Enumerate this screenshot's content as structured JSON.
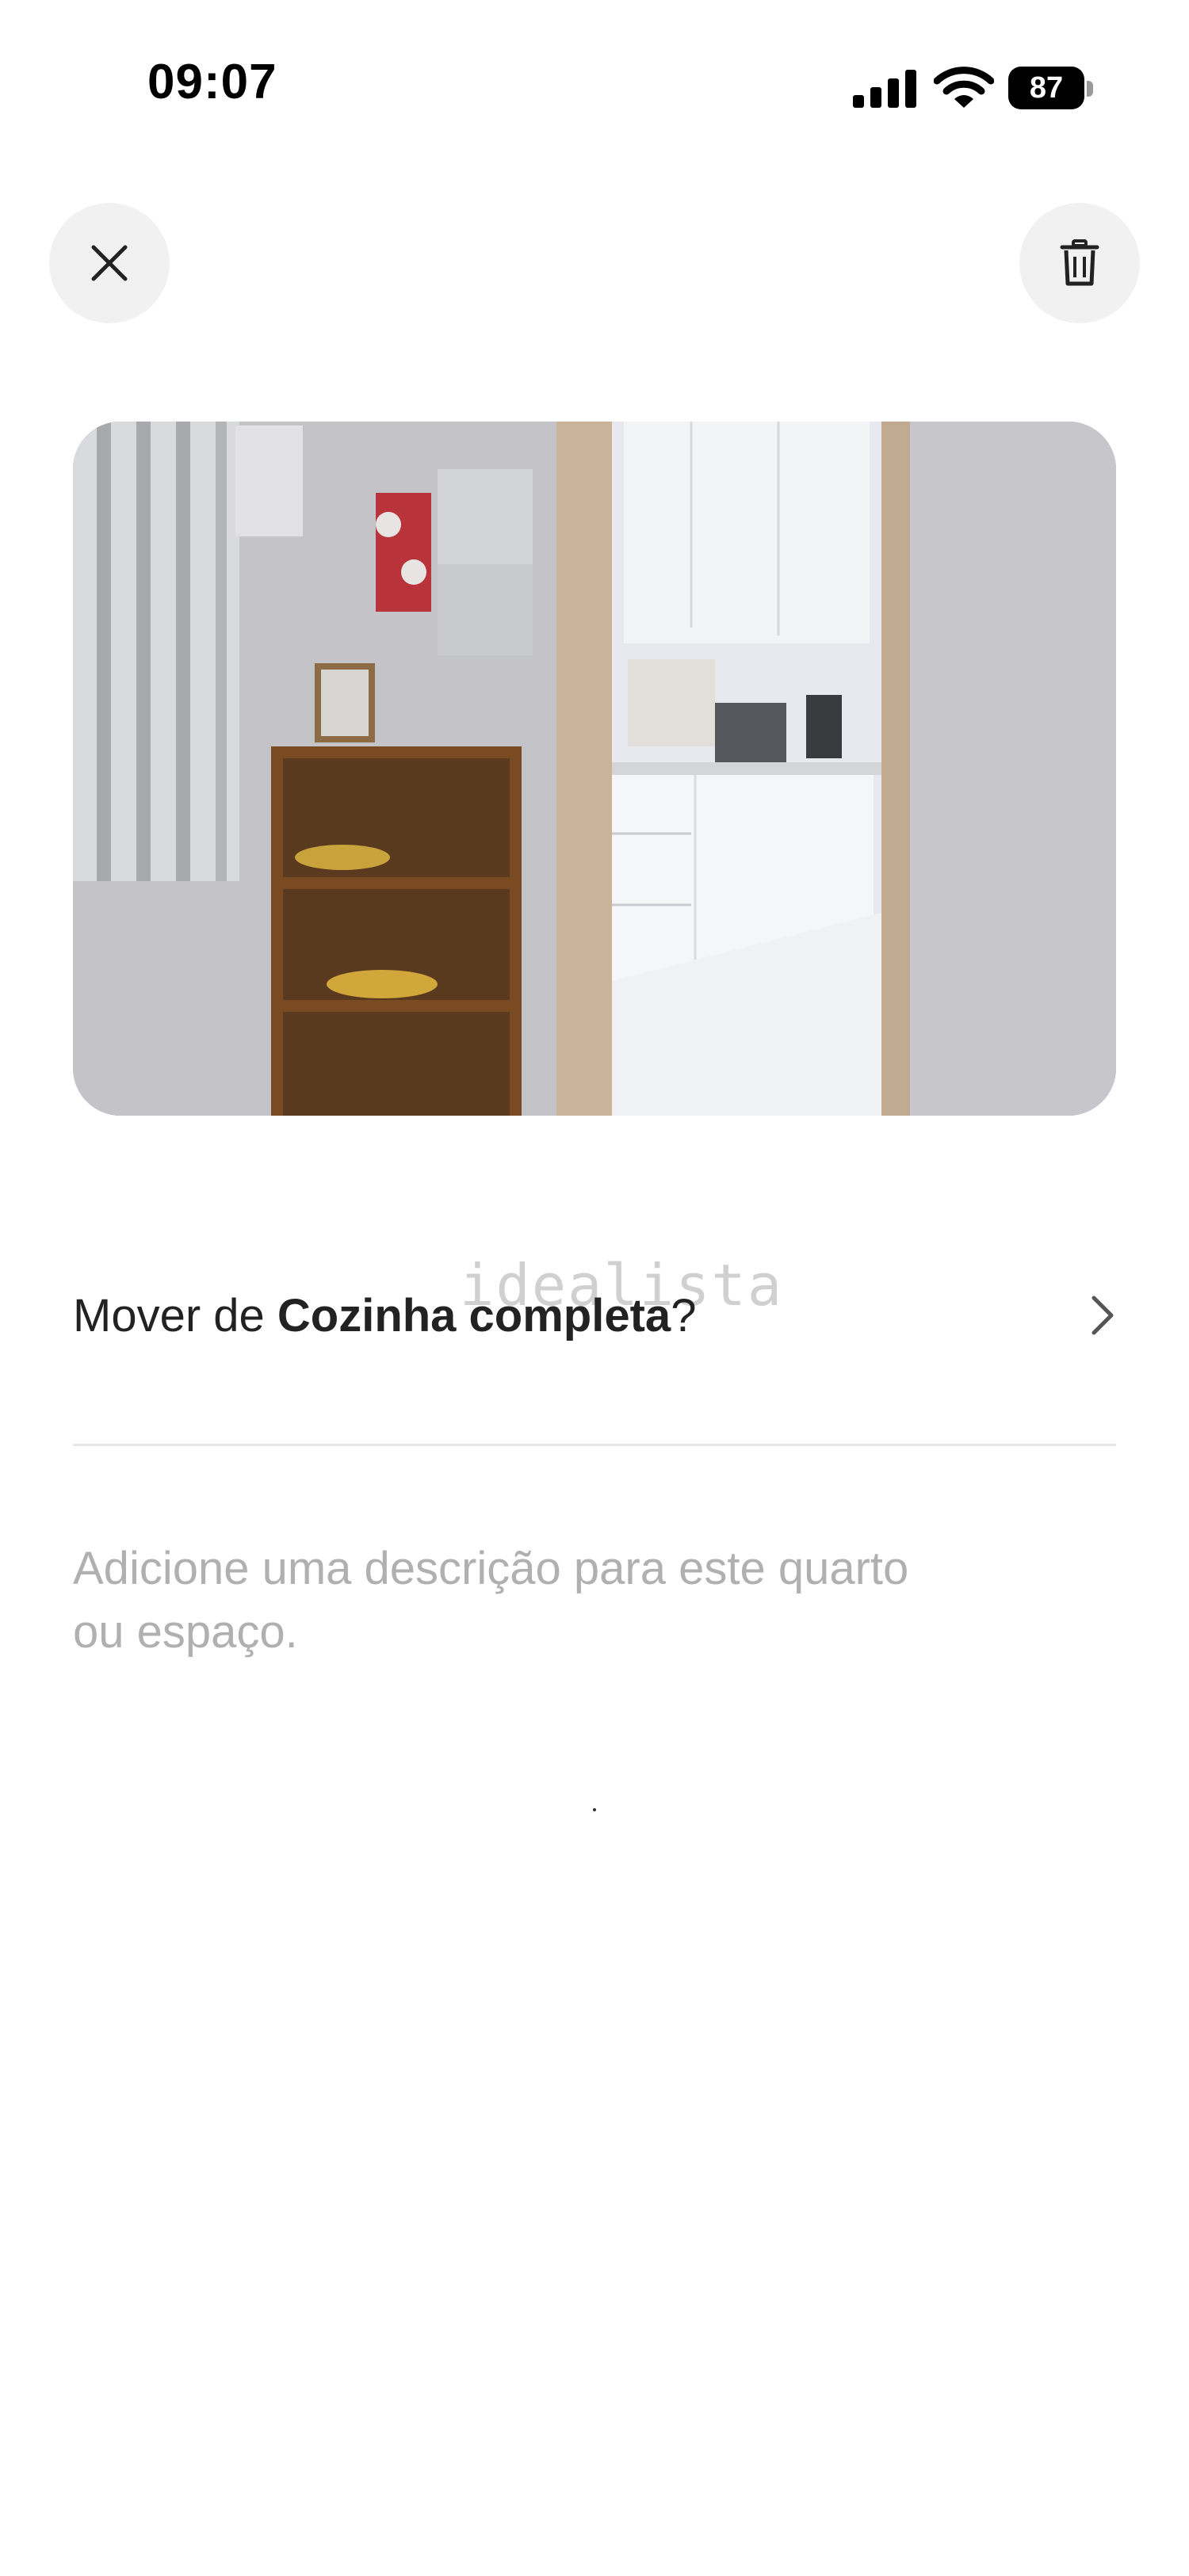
{
  "status_bar": {
    "time": "09:07",
    "battery_level": "87",
    "icons": [
      "signal-icon",
      "wifi-icon",
      "battery-icon"
    ]
  },
  "toolbar": {
    "close_icon": "close-icon",
    "delete_icon": "trash-icon"
  },
  "photo": {
    "watermark": "idealista"
  },
  "move": {
    "prefix": "Mover de ",
    "room": "Cozinha completa",
    "suffix": "?",
    "icon": "chevron-right-icon"
  },
  "description": {
    "placeholder": "Adicione uma descrição para este quarto\nou espaço."
  },
  "colors": {
    "background": "#ffffff",
    "button_bg": "#f1f1f1",
    "text_primary": "#222222",
    "text_placeholder": "#b0b0b0",
    "divider": "#e6e6e6"
  }
}
